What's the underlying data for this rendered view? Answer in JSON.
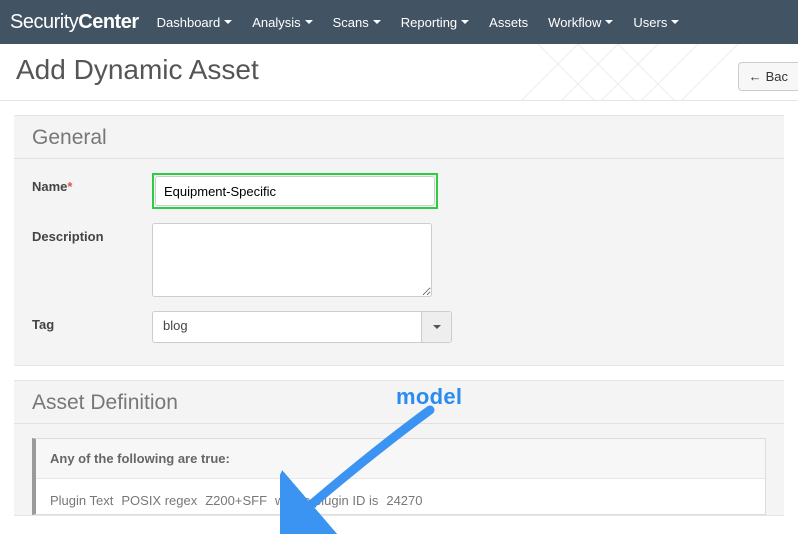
{
  "brand": {
    "part1": "Security",
    "part2": "Center"
  },
  "nav": {
    "dashboard": "Dashboard",
    "analysis": "Analysis",
    "scans": "Scans",
    "reporting": "Reporting",
    "assets": "Assets",
    "workflow": "Workflow",
    "users": "Users"
  },
  "header": {
    "title": "Add Dynamic Asset",
    "back_label": "Bac"
  },
  "general": {
    "heading": "General",
    "name_label": "Name",
    "name_value": "Equipment-Specific",
    "description_label": "Description",
    "description_value": "",
    "tag_label": "Tag",
    "tag_value": "blog"
  },
  "asset_def": {
    "heading": "Asset Definition",
    "group_label": "Any of the following are true:",
    "rule": {
      "field": "Plugin Text",
      "operator": "POSIX regex",
      "value": "Z200+SFF",
      "where_text": "where plugin ID is",
      "plugin_id": "24270"
    }
  },
  "annotation": {
    "label": "model"
  }
}
